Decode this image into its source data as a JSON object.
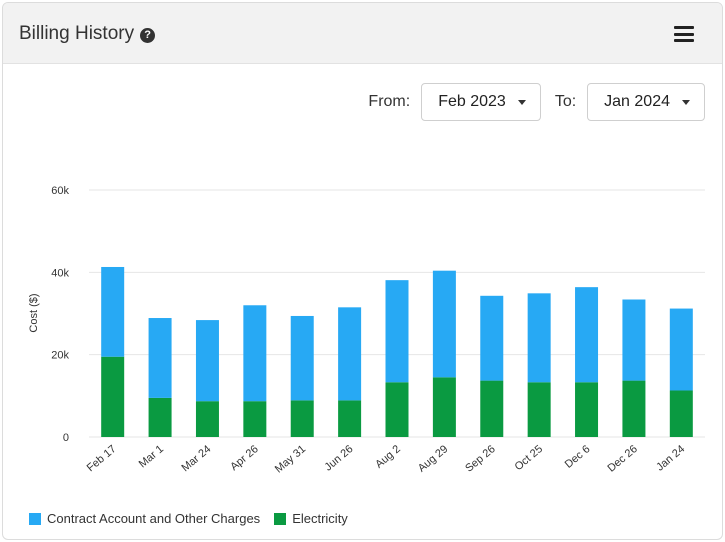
{
  "header": {
    "title": "Billing History",
    "help_icon": "question-circle-icon",
    "menu_icon": "hamburger-menu-icon"
  },
  "filters": {
    "from_label": "From:",
    "from_value": "Feb 2023",
    "to_label": "To:",
    "to_value": "Jan 2024"
  },
  "colors": {
    "contract": "#27a9f4",
    "electricity": "#0a9a41"
  },
  "chart_data": {
    "type": "bar",
    "stacked": true,
    "title": "",
    "xlabel": "",
    "ylabel": "Cost ($)",
    "ylim": [
      0,
      60000
    ],
    "yticks": [
      0,
      20000,
      40000,
      60000
    ],
    "ytick_labels": [
      "0",
      "20k",
      "40k",
      "60k"
    ],
    "grid": true,
    "legend_position": "bottom-left",
    "categories": [
      "Feb 17",
      "Mar 1",
      "Mar 24",
      "Apr 26",
      "May 31",
      "Jun 26",
      "Aug 2",
      "Aug 29",
      "Sep 26",
      "Oct 25",
      "Dec 6",
      "Dec 26",
      "Jan 24"
    ],
    "series": [
      {
        "name": "Electricity",
        "values": [
          19500,
          9500,
          8700,
          8700,
          8900,
          8900,
          13300,
          14500,
          13700,
          13300,
          13300,
          13700,
          11300
        ]
      },
      {
        "name": "Contract Account and Other Charges",
        "values": [
          21800,
          19400,
          19700,
          23300,
          20500,
          22600,
          24800,
          25900,
          20600,
          21600,
          23100,
          19700,
          19900
        ]
      }
    ]
  }
}
